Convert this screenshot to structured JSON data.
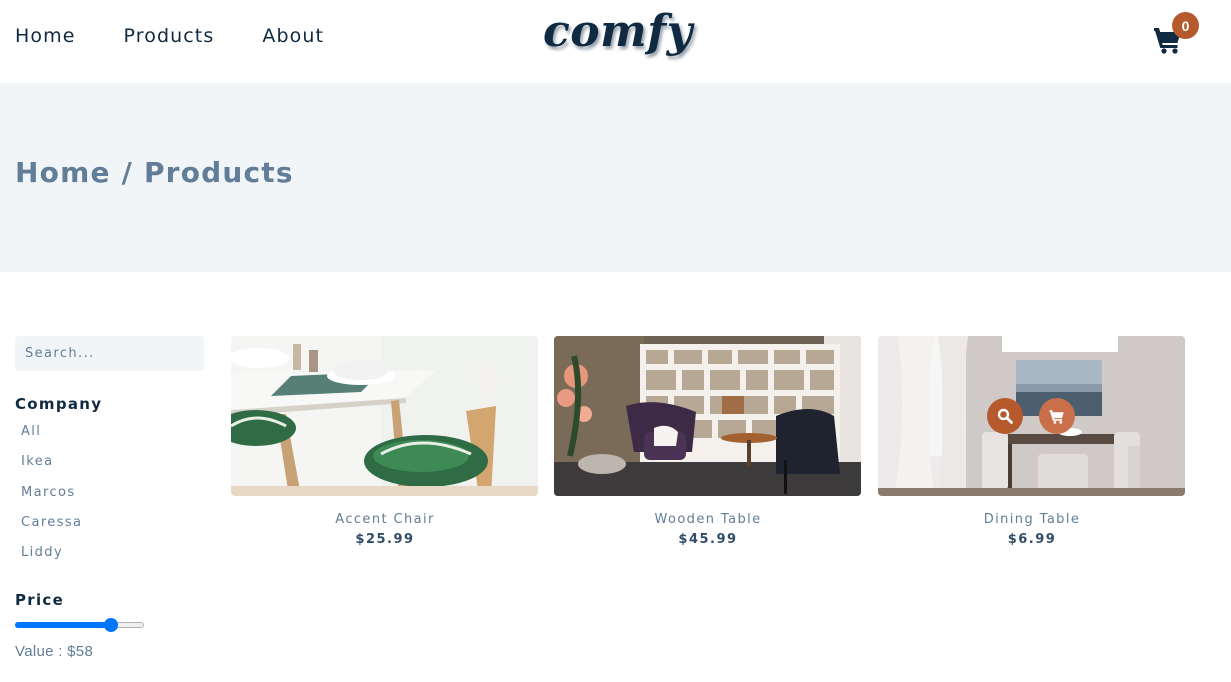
{
  "nav": {
    "links": [
      "Home",
      "Products",
      "About"
    ],
    "logo": "comfy",
    "cart_count": "0"
  },
  "hero": {
    "title": "Home / Products"
  },
  "filters": {
    "search_placeholder": "Search...",
    "company_heading": "Company",
    "companies": [
      "All",
      "Ikea",
      "Marcos",
      "Caressa",
      "Liddy"
    ],
    "price_heading": "Price",
    "price_value_text": "Value : $58",
    "price_slider_value": 58,
    "price_slider_max": 75
  },
  "products": [
    {
      "name": "Accent Chair",
      "price": "$25.99"
    },
    {
      "name": "Wooden Table",
      "price": "$45.99"
    },
    {
      "name": "Dining Table",
      "price": "$6.99"
    }
  ],
  "colors": {
    "primary_dark": "#102a42",
    "muted_text": "#617d98",
    "hero_bg": "#f1f5f8",
    "accent": "#b6592c",
    "slider_blue": "#0075ff"
  },
  "icons": {
    "cart": "cart-icon",
    "search": "search-icon"
  }
}
